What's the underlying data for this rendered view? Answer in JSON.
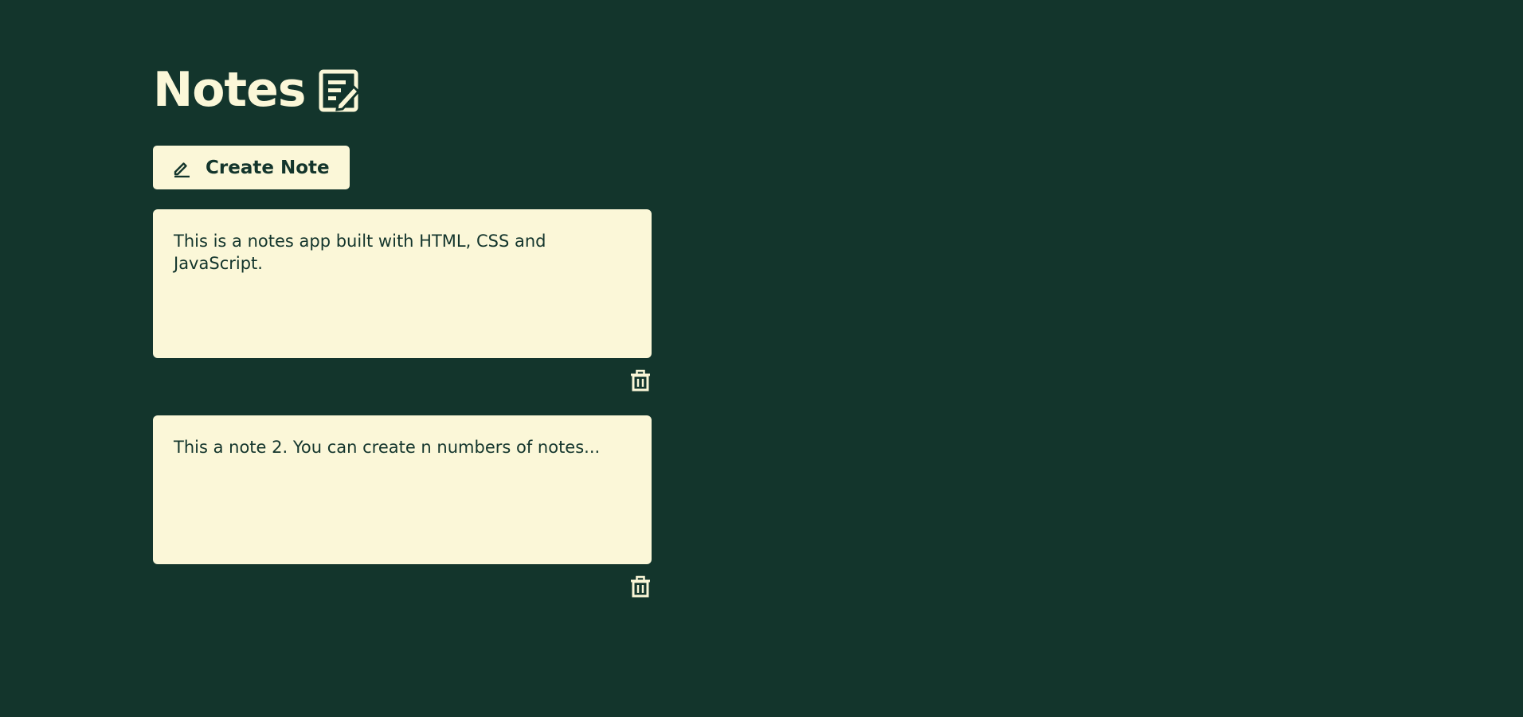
{
  "app": {
    "title": "Notes",
    "title_icon": "note-edit-icon",
    "create_button_label": "Create Note",
    "create_button_icon": "pencil-icon",
    "delete_icon": "trash-icon"
  },
  "notes": [
    {
      "text": "This is a notes app built with HTML, CSS and JavaScript."
    },
    {
      "text": "This a note 2. You can create n numbers of notes..."
    }
  ],
  "colors": {
    "background": "#13352c",
    "accent": "#fbf7d8"
  }
}
